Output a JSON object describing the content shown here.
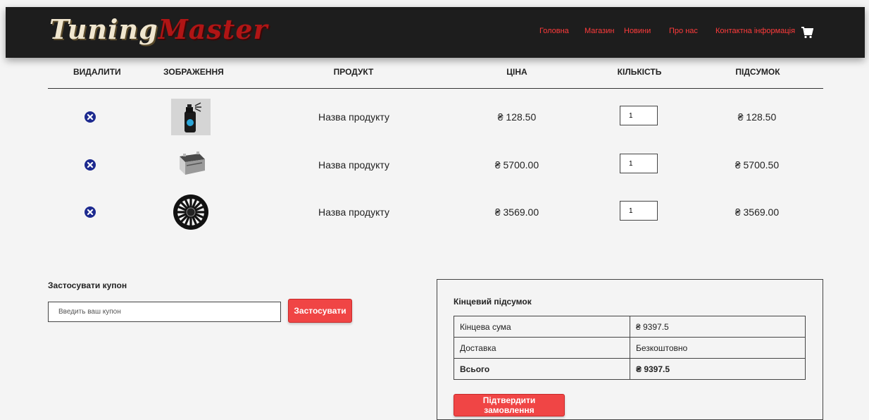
{
  "header": {
    "logo_part1": "Tuning",
    "logo_part2": "Master",
    "nav": [
      "Головна",
      "Магазин",
      "Новини",
      "Про нас",
      "Контактна інформація"
    ]
  },
  "table": {
    "headers": {
      "remove": "ВИДАЛИТИ",
      "image": "ЗОБРАЖЕННЯ",
      "product": "ПРОДУКТ",
      "price": "ЦІНА",
      "quantity": "КІЛЬКІСТЬ",
      "subtotal": "ПІДСУМОК"
    },
    "rows": [
      {
        "image_icon": "spray-can-icon",
        "name": "Назва продукту",
        "price": "₴ 128.50",
        "qty": "1",
        "subtotal": "₴ 128.50"
      },
      {
        "image_icon": "car-battery-icon",
        "name": "Назва продукту",
        "price": "₴ 5700.00",
        "qty": "1",
        "subtotal": "₴ 5700.50"
      },
      {
        "image_icon": "wheel-rim-icon",
        "name": "Назва продукту",
        "price": "₴ 3569.00",
        "qty": "1",
        "subtotal": "₴ 3569.00"
      }
    ]
  },
  "coupon": {
    "title": "Застосувати купон",
    "placeholder": "Введить ваш купон",
    "apply_label": "Застосувати"
  },
  "summary": {
    "title": "Кінцевий підсумок",
    "rows": [
      {
        "label": "Кінцева сума",
        "value": "₴ 9397.5"
      },
      {
        "label": "Доставка",
        "value": "Безкоштовно"
      },
      {
        "label": "Всього",
        "value": "₴ 9397.5"
      }
    ],
    "confirm_label": "Підтвердити замовлення"
  },
  "colors": {
    "navbar": "#1d1d1d",
    "nav_link": "#ff3b3b",
    "accent_button": "#f04545",
    "remove_icon": "#1d2a8f"
  }
}
